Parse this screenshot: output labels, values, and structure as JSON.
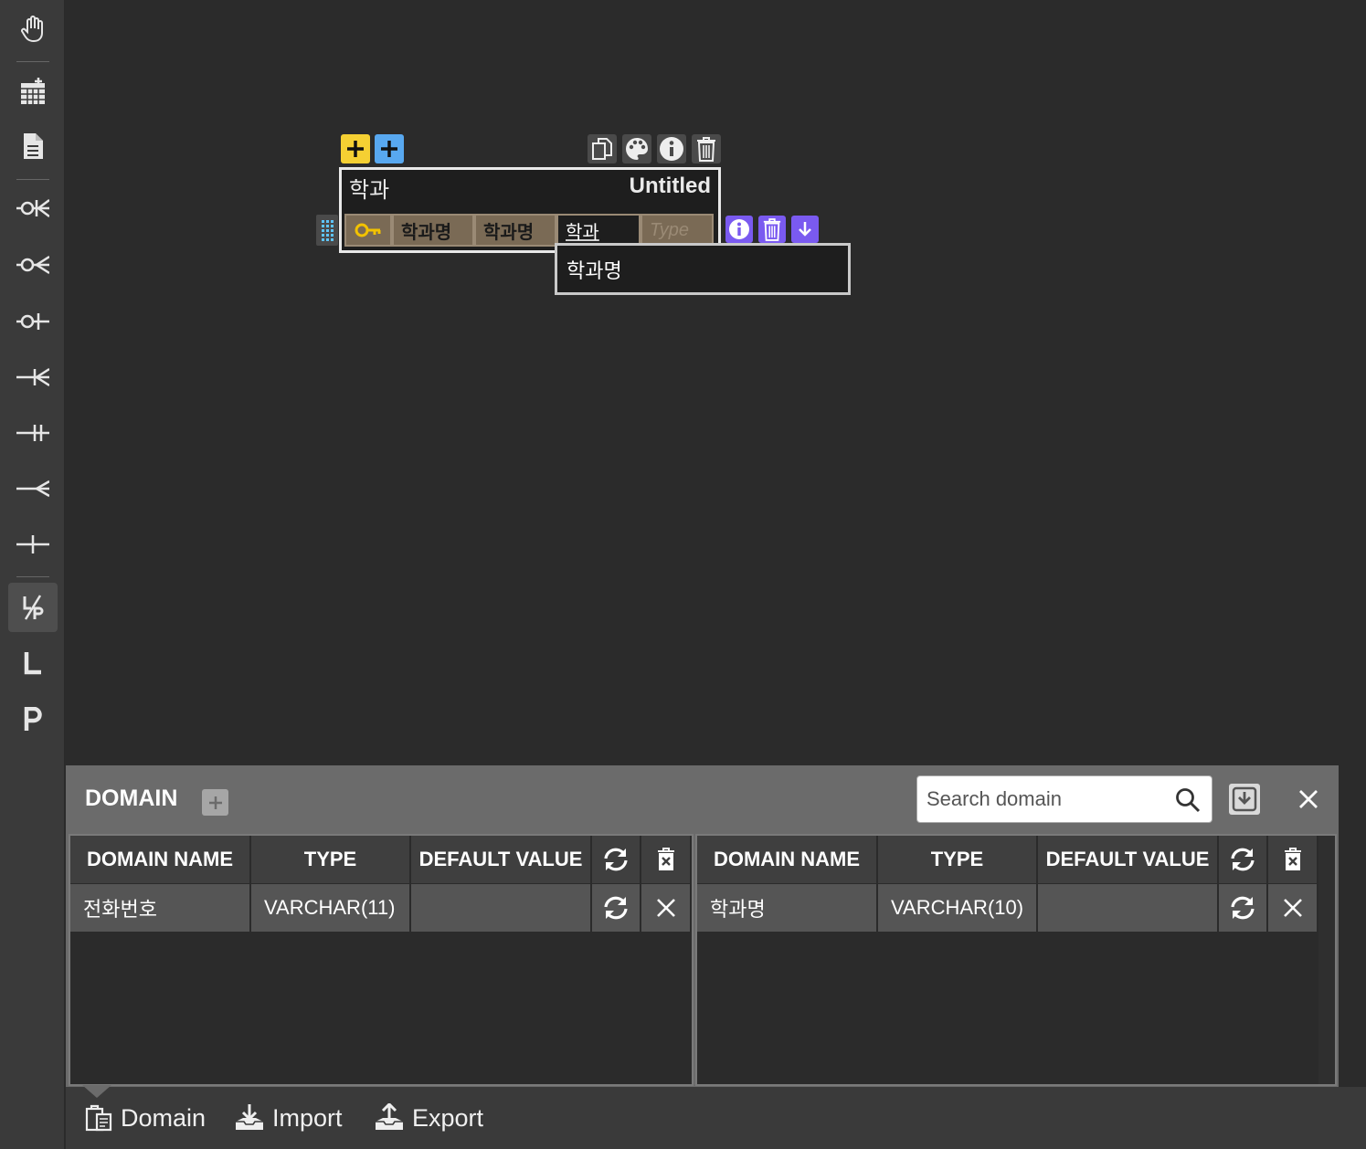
{
  "toolbar": {
    "tools": [
      {
        "icon": "hand-icon"
      },
      {
        "icon": "table-add-icon"
      },
      {
        "icon": "memo-icon"
      },
      {
        "icon": "zero-one-n-icon"
      },
      {
        "icon": "zero-n-icon"
      },
      {
        "icon": "zero-one-icon"
      },
      {
        "icon": "one-n-icon"
      },
      {
        "icon": "one-only-icon"
      },
      {
        "icon": "n-icon"
      },
      {
        "icon": "one-icon"
      },
      {
        "icon": "identification-icon"
      },
      {
        "icon": "logical-icon"
      },
      {
        "icon": "physical-icon"
      }
    ]
  },
  "erd_table": {
    "name": "학과",
    "comment": "Untitled",
    "columns": [
      {
        "name": "학과명",
        "domain": "학과명"
      }
    ],
    "editing_value": "학과",
    "type_placeholder": "Type",
    "autocomplete_item": "학과명"
  },
  "domain_panel": {
    "title": "DOMAIN",
    "search_placeholder": "Search domain",
    "headers": {
      "name": "DOMAIN NAME",
      "type": "TYPE",
      "default": "DEFAULT VALUE"
    },
    "left_rows": [
      {
        "name": "전화번호",
        "type": "VARCHAR(11)",
        "default": ""
      }
    ],
    "right_rows": [
      {
        "name": "학과명",
        "type": "VARCHAR(10)",
        "default": ""
      }
    ]
  },
  "bottom_tabs": {
    "domain": "Domain",
    "import": "Import",
    "export": "Export"
  },
  "colors": {
    "accent_yellow": "#f5d033",
    "accent_blue": "#58a8f0",
    "accent_purple": "#7a5af0",
    "column_bg": "#7a6a55"
  }
}
